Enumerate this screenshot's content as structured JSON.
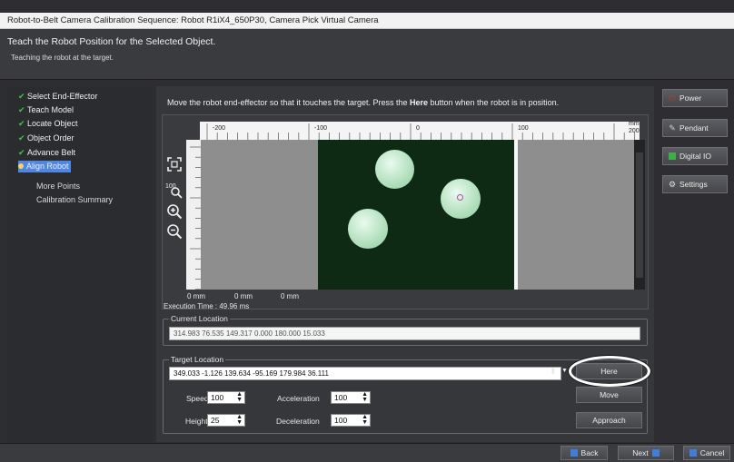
{
  "window": {
    "title": "Robot-to-Belt Camera Calibration Sequence: Robot R1iX4_650P30, Camera Pick Virtual Camera"
  },
  "header": {
    "title": "Teach the Robot Position for the Selected Object.",
    "subtitle": "Teaching the robot at the target."
  },
  "steps": [
    {
      "label": "Select End-Effector",
      "state": "done"
    },
    {
      "label": "Teach Model",
      "state": "done"
    },
    {
      "label": "Locate Object",
      "state": "done"
    },
    {
      "label": "Object Order",
      "state": "done"
    },
    {
      "label": "Advance Belt",
      "state": "done"
    },
    {
      "label": "Align Robot",
      "state": "active"
    },
    {
      "label": "More Points",
      "state": "pending"
    },
    {
      "label": "Calibration Summary",
      "state": "pending"
    }
  ],
  "instruction": {
    "before": "Move the robot end-effector so that it touches the target. Press the ",
    "bold": "Here",
    "after": " button when the robot is in position."
  },
  "ruler": {
    "unit": "mm",
    "ticks": [
      "-200",
      "-100",
      "0",
      "100",
      "200"
    ]
  },
  "coords": [
    "0 mm",
    "0 mm",
    "0 mm"
  ],
  "execution_time": "Execution Time : 49.96 ms",
  "current_location": {
    "legend": "Current Location",
    "value": "314.983 76.535 149.317 0.000 180.000 15.033"
  },
  "target_location": {
    "legend": "Target Location",
    "value": "349.033 -1.126 139.634 -95.169 179.984 36.111"
  },
  "speed": {
    "label": "Speed",
    "value": "100"
  },
  "height": {
    "label": "Height",
    "value": "25"
  },
  "acceleration": {
    "label": "Acceleration",
    "value": "100"
  },
  "deceleration": {
    "label": "Deceleration",
    "value": "100"
  },
  "buttons": {
    "here": "Here",
    "move": "Move",
    "approach": "Approach"
  },
  "side_buttons": {
    "power": "Power",
    "pendant": "Pendant",
    "digital_io": "Digital IO",
    "settings": "Settings"
  },
  "footer": {
    "back": "Back",
    "next": "Next",
    "cancel": "Cancel"
  },
  "icons": [
    "check-icon",
    "zoom-fit-icon",
    "zoom-100-icon",
    "zoom-in-icon",
    "zoom-out-icon",
    "power-icon",
    "pendant-icon",
    "digital-io-icon",
    "settings-icon",
    "back-arrow-icon",
    "next-arrow-icon",
    "cancel-icon"
  ],
  "colors": {
    "accent": "#4f86e0",
    "check": "#46c34b",
    "power": "#c0392b",
    "digital_io": "#3fae4a"
  }
}
